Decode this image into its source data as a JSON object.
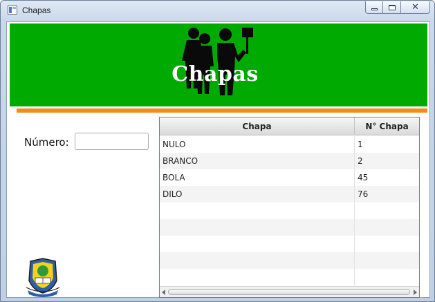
{
  "window": {
    "title": "Chapas",
    "icon": "app-window-icon",
    "controls": [
      "minimize-icon",
      "maximize-icon",
      "close-icon"
    ],
    "close_glyph": "✕"
  },
  "banner": {
    "title": "Chapas",
    "background": "#00aa00",
    "accent_bar": "#f28b17",
    "art": "protesters-with-sign-icon"
  },
  "form": {
    "numero_label": "Número:",
    "numero_value": "",
    "numero_placeholder": ""
  },
  "table": {
    "columns": [
      "Chapa",
      "N° Chapa"
    ],
    "rows": [
      {
        "chapa": "NULO",
        "numero": "1"
      },
      {
        "chapa": "BRANCO",
        "numero": "2"
      },
      {
        "chapa": "BOLA",
        "numero": "45"
      },
      {
        "chapa": "DILO",
        "numero": "76"
      },
      {
        "chapa": "",
        "numero": ""
      },
      {
        "chapa": "",
        "numero": ""
      },
      {
        "chapa": "",
        "numero": ""
      },
      {
        "chapa": "",
        "numero": ""
      },
      {
        "chapa": "",
        "numero": ""
      }
    ]
  },
  "logo": "school-crest-icon"
}
